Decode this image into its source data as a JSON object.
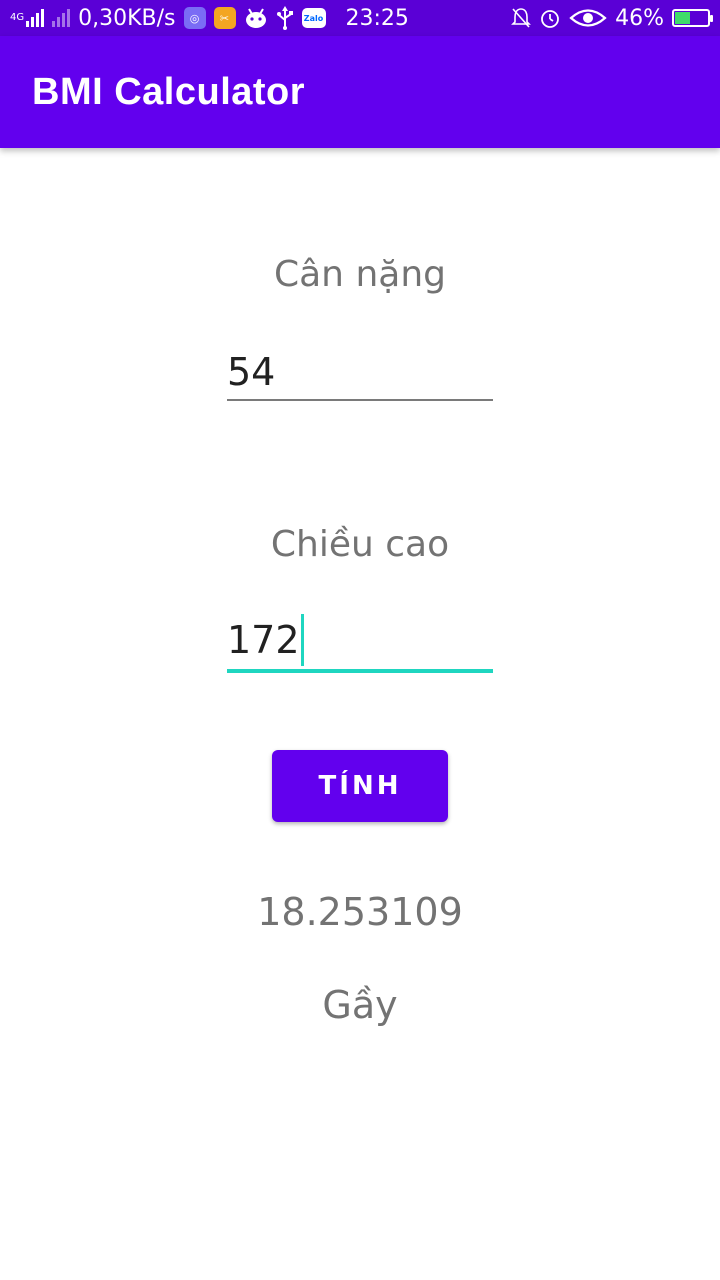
{
  "status_bar": {
    "network_type": "4G",
    "data_speed": "0,30KB/s",
    "zalo_label": "Zalo",
    "time": "23:25",
    "battery_percent": "46%",
    "battery_level": 0.46,
    "icons": [
      "signal-icon",
      "signal-weak-icon",
      "app-badge-icon",
      "app-badge-2-icon",
      "android-icon",
      "usb-icon",
      "zalo-icon",
      "silent-bell-icon",
      "alarm-icon",
      "eye-icon",
      "battery-charging-icon"
    ]
  },
  "app_bar": {
    "title": "BMI Calculator"
  },
  "form": {
    "weight_label": "Cân nặng",
    "weight_value": "54",
    "height_label": "Chiều cao",
    "height_value": "172"
  },
  "button": {
    "label": "TÍNH"
  },
  "result": {
    "bmi_value": "18.253109",
    "category": "Gầy"
  },
  "colors": {
    "status_bar": "#5a00d6",
    "primary": "#6200ee",
    "accent": "#1fd6c0",
    "label_text": "#737373"
  }
}
